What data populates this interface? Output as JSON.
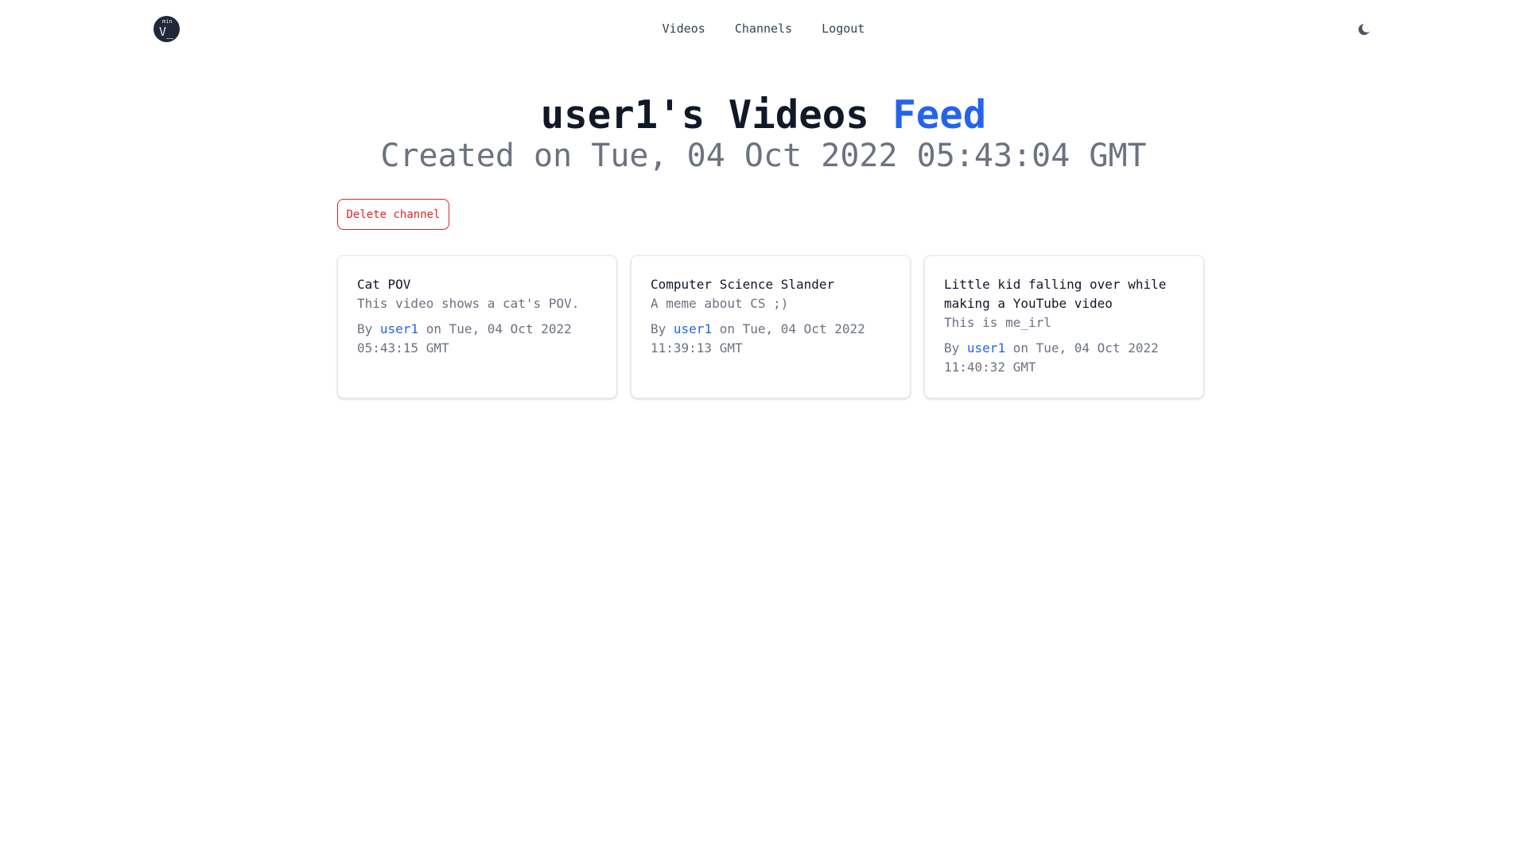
{
  "nav": {
    "logo_top": "min",
    "logo_main": "V_",
    "links": [
      "Videos",
      "Channels",
      "Logout"
    ],
    "theme_icon": "moon-icon"
  },
  "header": {
    "title_main": "user1's Videos ",
    "title_accent": "Feed",
    "subtitle": "Created on Tue, 04 Oct 2022 05:43:04 GMT"
  },
  "actions": {
    "delete_label": "Delete channel"
  },
  "videos": [
    {
      "title": "Cat POV",
      "description": "This video shows a cat's POV.",
      "by_label": "By ",
      "author": "user1",
      "date_text": " on Tue, 04 Oct 2022 05:43:15 GMT"
    },
    {
      "title": "Computer Science Slander",
      "description": "A meme about CS ;)",
      "by_label": "By ",
      "author": "user1",
      "date_text": " on Tue, 04 Oct 2022 11:39:13 GMT"
    },
    {
      "title": "Little kid falling over while making a YouTube video",
      "description": "This is me_irl",
      "by_label": "By ",
      "author": "user1",
      "date_text": " on Tue, 04 Oct 2022 11:40:32 GMT"
    }
  ],
  "colors": {
    "accent": "#2563eb",
    "danger": "#dc2626",
    "muted": "#6b7280",
    "text": "#111827"
  }
}
